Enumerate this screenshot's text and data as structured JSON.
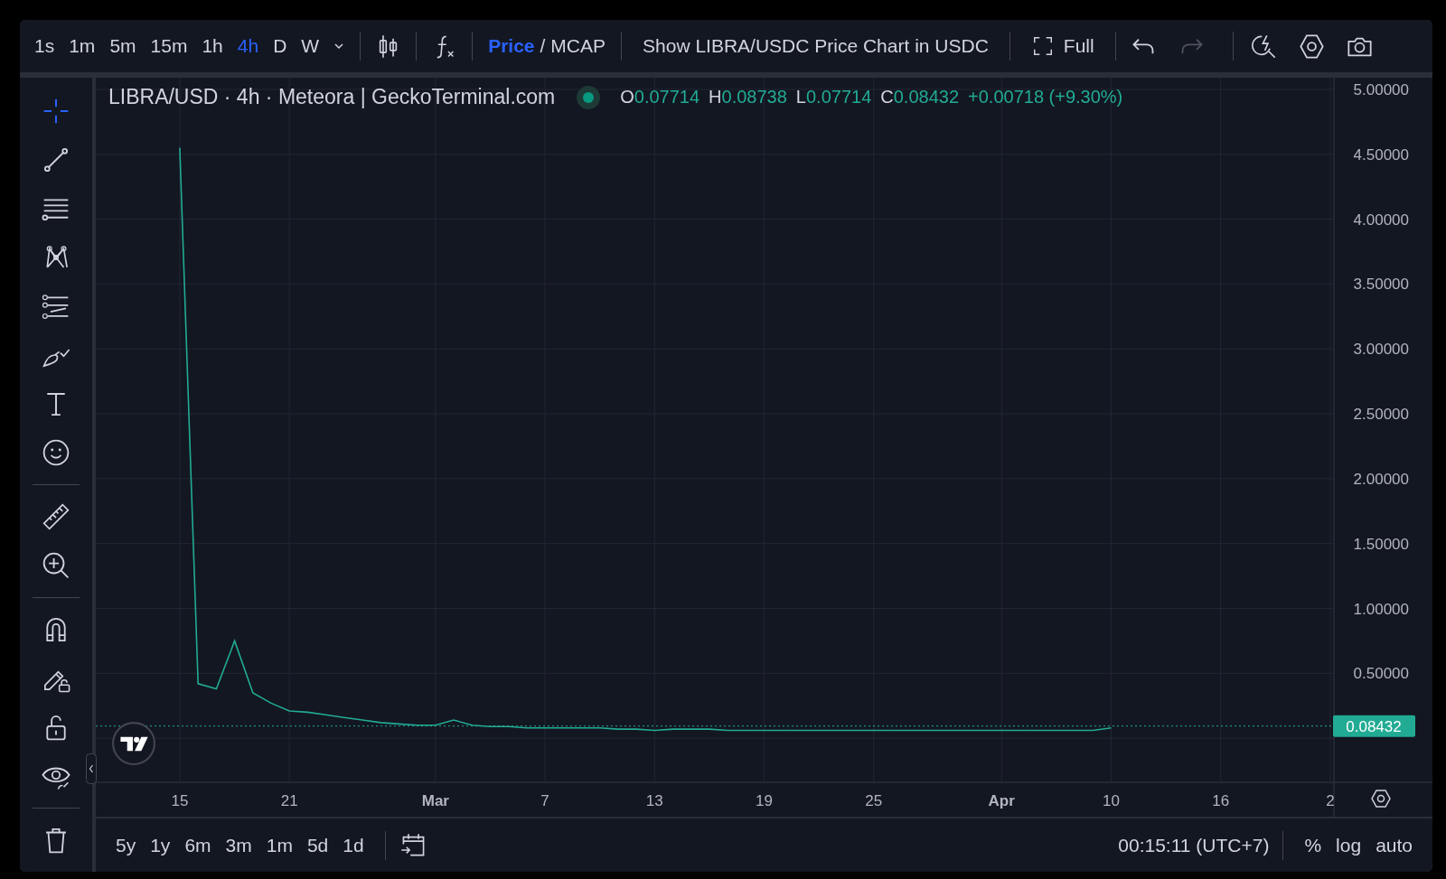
{
  "toolbar": {
    "intervals": [
      {
        "label": "1s",
        "selected": false
      },
      {
        "label": "1m",
        "selected": false
      },
      {
        "label": "5m",
        "selected": false
      },
      {
        "label": "15m",
        "selected": false
      },
      {
        "label": "1h",
        "selected": false
      },
      {
        "label": "4h",
        "selected": true
      },
      {
        "label": "D",
        "selected": false
      },
      {
        "label": "W",
        "selected": false
      }
    ],
    "price_mcap": [
      {
        "label": "Price",
        "selected": true
      },
      {
        "label": "MCAP",
        "selected": false
      }
    ],
    "price_mcap_separator": "/",
    "show_button": "Show LIBRA/USDC Price Chart in USDC",
    "full_button": "Full",
    "undo": {
      "disabled": false
    },
    "redo": {
      "disabled": true
    }
  },
  "drawing_tools": [
    [
      {
        "selected": true
      },
      {
        "selected": false
      },
      {
        "selected": false
      },
      {
        "selected": false
      },
      {
        "selected": false
      },
      {
        "selected": false
      },
      {
        "selected": false
      },
      {
        "selected": false
      }
    ],
    [
      {
        "selected": false
      },
      {
        "selected": false
      }
    ],
    [
      {
        "selected": false
      },
      {
        "selected": false
      },
      {
        "selected": false
      },
      {
        "selected": false
      }
    ],
    [
      {
        "selected": false
      }
    ]
  ],
  "legend": {
    "title": "LIBRA/USD · 4h · Meteora | GeckoTerminal.com",
    "ohlc": [
      {
        "label": "O",
        "value": "0.07714"
      },
      {
        "label": "H",
        "value": "0.08738"
      },
      {
        "label": "L",
        "value": "0.07714"
      },
      {
        "label": "C",
        "value": "0.08432"
      }
    ],
    "change": "+0.00718 (+9.30%)"
  },
  "chart_data": {
    "type": "line",
    "categories": [
      null,
      null,
      null,
      null,
      "15",
      null,
      null,
      null,
      null,
      null,
      "21",
      null,
      null,
      null,
      null,
      null,
      null,
      null,
      "Mar",
      null,
      null,
      null,
      null,
      null,
      "7",
      null,
      null,
      null,
      null,
      null,
      "13",
      null,
      null,
      null,
      null,
      null,
      "19",
      null,
      null,
      null,
      null,
      null,
      "25",
      null,
      null,
      null,
      null,
      null,
      null,
      "Apr",
      null,
      null,
      null,
      null,
      null,
      "10",
      null,
      null,
      null,
      null,
      null,
      "16",
      null,
      null,
      null,
      null,
      null,
      "2"
    ],
    "series": [
      {
        "color": "#22ab94",
        "values": [
          null,
          null,
          null,
          null,
          4.55,
          0.42,
          0.38,
          0.75,
          0.35,
          0.27,
          0.21,
          0.2,
          0.18,
          0.16,
          0.14,
          0.12,
          0.11,
          0.1,
          0.1,
          0.14,
          0.1,
          0.09,
          0.09,
          0.08,
          0.08,
          0.08,
          0.08,
          0.08,
          0.07,
          0.07,
          0.06,
          0.07,
          0.07,
          0.07,
          0.06,
          0.06,
          0.06,
          0.06,
          0.06,
          0.06,
          0.06,
          0.06,
          0.06,
          0.06,
          0.06,
          0.06,
          0.06,
          0.06,
          0.06,
          0.06,
          0.06,
          0.06,
          0.06,
          0.06,
          0.06,
          0.08,
          null,
          null,
          null,
          null,
          null,
          null,
          null,
          null,
          null,
          null,
          null,
          null
        ]
      }
    ],
    "ylim": [
      -0.34,
      5.09
    ],
    "grid": true,
    "yticks": [
      {
        "value": 0.5,
        "label": "0.50000"
      },
      {
        "value": 1,
        "label": "1.00000"
      },
      {
        "value": 1.5,
        "label": "1.50000"
      },
      {
        "value": 2,
        "label": "2.00000"
      },
      {
        "value": 2.5,
        "label": "2.50000"
      },
      {
        "value": 3,
        "label": "3.00000"
      },
      {
        "value": 3.5,
        "label": "3.50000"
      },
      {
        "value": 4,
        "label": "4.00000"
      },
      {
        "value": 4.5,
        "label": "4.50000"
      },
      {
        "value": 5,
        "label": "5.00000"
      }
    ]
  },
  "price_tag": "0.08432",
  "ranges": [
    "5y",
    "1y",
    "6m",
    "3m",
    "1m",
    "5d",
    "1d"
  ],
  "clock": "00:15:11 (UTC+7)",
  "scale_options": [
    "%",
    "log",
    "auto"
  ]
}
